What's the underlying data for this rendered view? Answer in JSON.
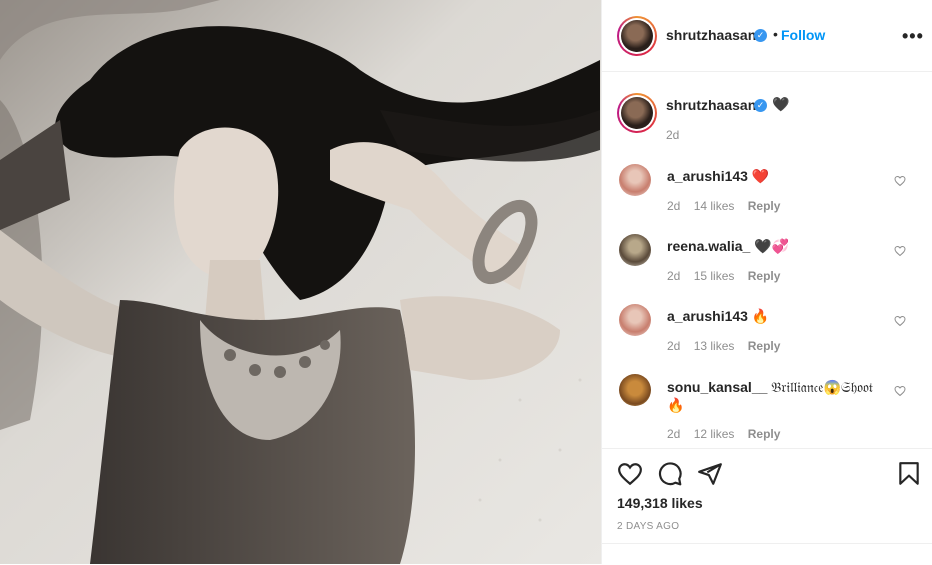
{
  "post": {
    "author": "shrutzhaasan",
    "follow_label": "Follow",
    "separator": "•",
    "more_label": "•••",
    "caption_time": "2d",
    "likes": "149,318 likes",
    "posted_ago": "2 DAYS AGO"
  },
  "caption": {
    "user": "shrutzhaasan",
    "emoji": "🖤"
  },
  "comments": [
    {
      "user": "a_arushi143",
      "text": "❤️",
      "time": "2d",
      "likes": "14 likes",
      "reply": "Reply"
    },
    {
      "user": "reena.walia_",
      "text": "🖤💞",
      "time": "2d",
      "likes": "15 likes",
      "reply": "Reply"
    },
    {
      "user": "a_arushi143",
      "text": "🔥",
      "time": "2d",
      "likes": "13 likes",
      "reply": "Reply"
    },
    {
      "user": "sonu_kansal__",
      "text": "𝔅𝔯𝔦𝔩𝔩𝔦𝔞𝔫𝔠𝔢😱𝔖𝔥𝔬𝔬𝔱",
      "text2": "🔥",
      "time": "2d",
      "likes": "12 likes",
      "reply": "Reply"
    }
  ],
  "colors": {
    "link": "#0095f6",
    "verified": "#3897f0",
    "muted": "#8e8e8e",
    "text": "#262626"
  }
}
